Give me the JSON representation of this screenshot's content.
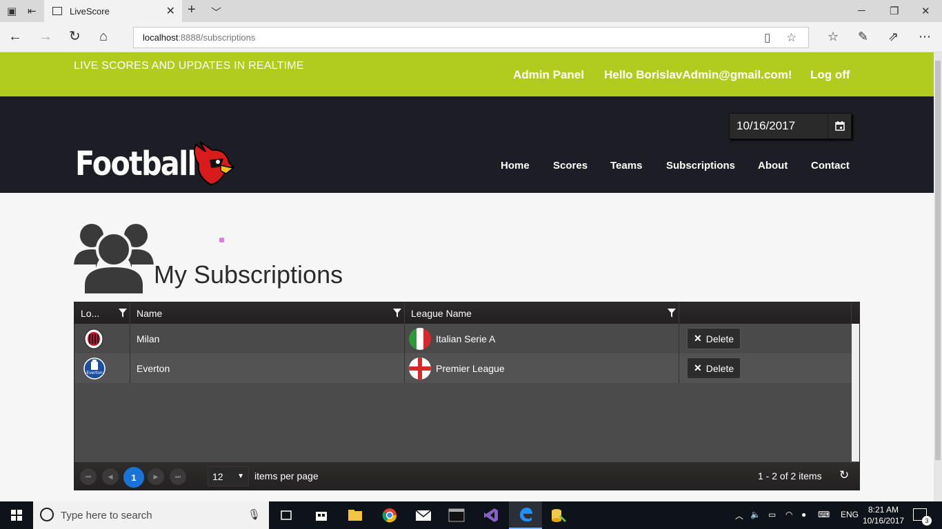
{
  "browser": {
    "tab_title": "LiveScore",
    "url_host": "localhost",
    "url_path": ":8888/subscriptions"
  },
  "header": {
    "tagline": "LIVE SCORES AND UPDATES IN REALTIME",
    "admin_panel": "Admin Panel",
    "greeting": "Hello BorislavAdmin@gmail.com!",
    "log_off": "Log off"
  },
  "logo": {
    "text": "Football"
  },
  "date_picker": {
    "value": "10/16/2017"
  },
  "nav": {
    "home": "Home",
    "scores": "Scores",
    "teams": "Teams",
    "subscriptions": "Subscriptions",
    "about": "About",
    "contact": "Contact"
  },
  "page": {
    "title": "My Subscriptions"
  },
  "grid": {
    "columns": [
      "Lo...",
      "Name",
      "League Name",
      ""
    ],
    "rows": [
      {
        "logo": "milan-badge",
        "name": "Milan",
        "league_flag": "italy-flag",
        "league": "Italian Serie A",
        "action": "Delete"
      },
      {
        "logo": "everton-badge",
        "name": "Everton",
        "league_flag": "england-flag",
        "league": "Premier League",
        "action": "Delete"
      }
    ],
    "pager": {
      "current_page": "1",
      "page_size": "12",
      "items_per_page_label": "items per page",
      "summary": "1 - 2 of 2 items"
    }
  },
  "taskbar": {
    "search_placeholder": "Type here to search",
    "language": "ENG",
    "time": "8:21 AM",
    "date": "10/16/2017",
    "notifications": "3"
  },
  "colors": {
    "topbar": "#b1cc1f",
    "masthead": "#1d1e25",
    "grid_body": "#4b4b4b",
    "pager_active": "#1a74d6"
  }
}
